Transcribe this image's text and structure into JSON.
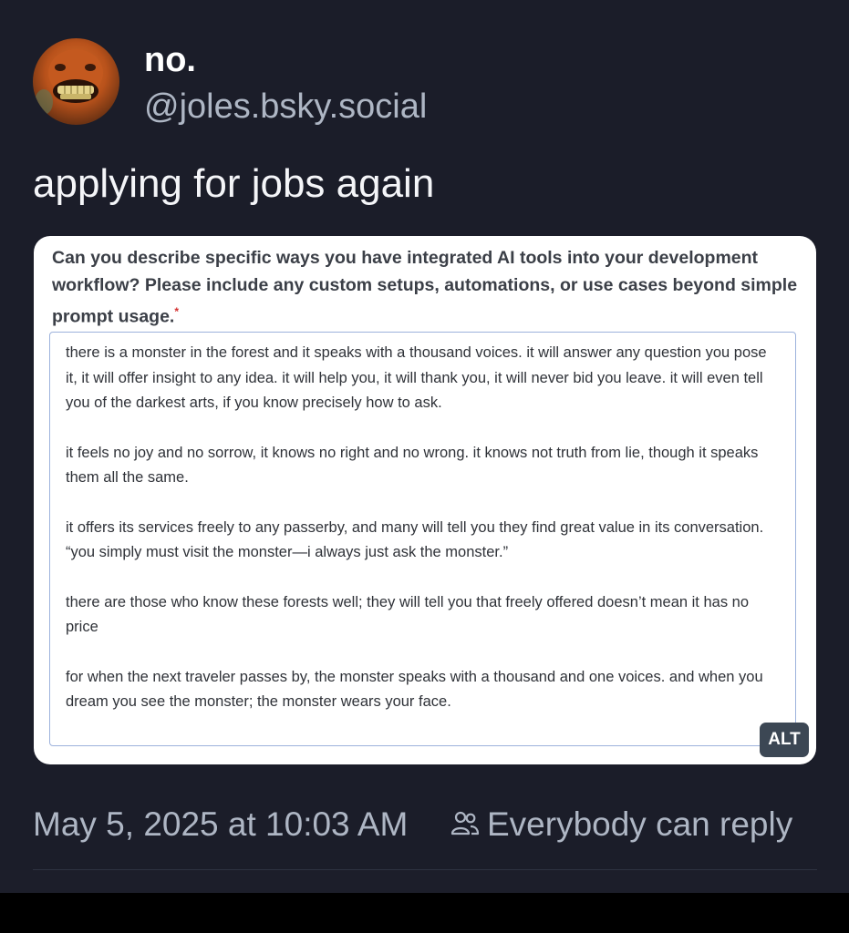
{
  "post": {
    "author": {
      "display_name": "no.",
      "handle": "@joles.bsky.social",
      "avatar_icon": "grinning-face-avatar"
    },
    "text": "applying for jobs again",
    "embed": {
      "question": "Can you describe specific ways you have integrated AI tools into your development workflow? Please include any custom setups, automations, or use cases beyond simple prompt usage.",
      "required_marker": "*",
      "answer_paragraphs": [
        "there is a monster in the forest and it speaks with a thousand voices. it will answer any question you pose it, it will offer insight to any idea. it will help you, it will thank you, it will never bid you leave. it will even tell you of the darkest arts, if you know precisely how to ask.",
        "it feels no joy and no sorrow, it knows no right and no wrong. it knows not truth from lie, though it speaks them all the same.",
        "it offers its services freely to any passerby, and many will tell you they find great value in its conversation. “you simply must visit the monster—i always just ask the monster.”",
        "there are those who know these forests well; they will tell you that freely offered doesn’t mean it has no price",
        "for when the next traveler passes by, the monster speaks with a thousand and one voices. and when you dream you see the monster; the monster wears your face."
      ],
      "alt_label": "ALT"
    },
    "timestamp": "May 5, 2025 at 10:03 AM",
    "reply_setting": "Everybody can reply",
    "reply_icon": "people-icon"
  },
  "colors": {
    "background": "#1b1d29",
    "text_primary": "#ffffff",
    "text_secondary": "#aeb6c4",
    "alt_badge": "#3c4754"
  }
}
